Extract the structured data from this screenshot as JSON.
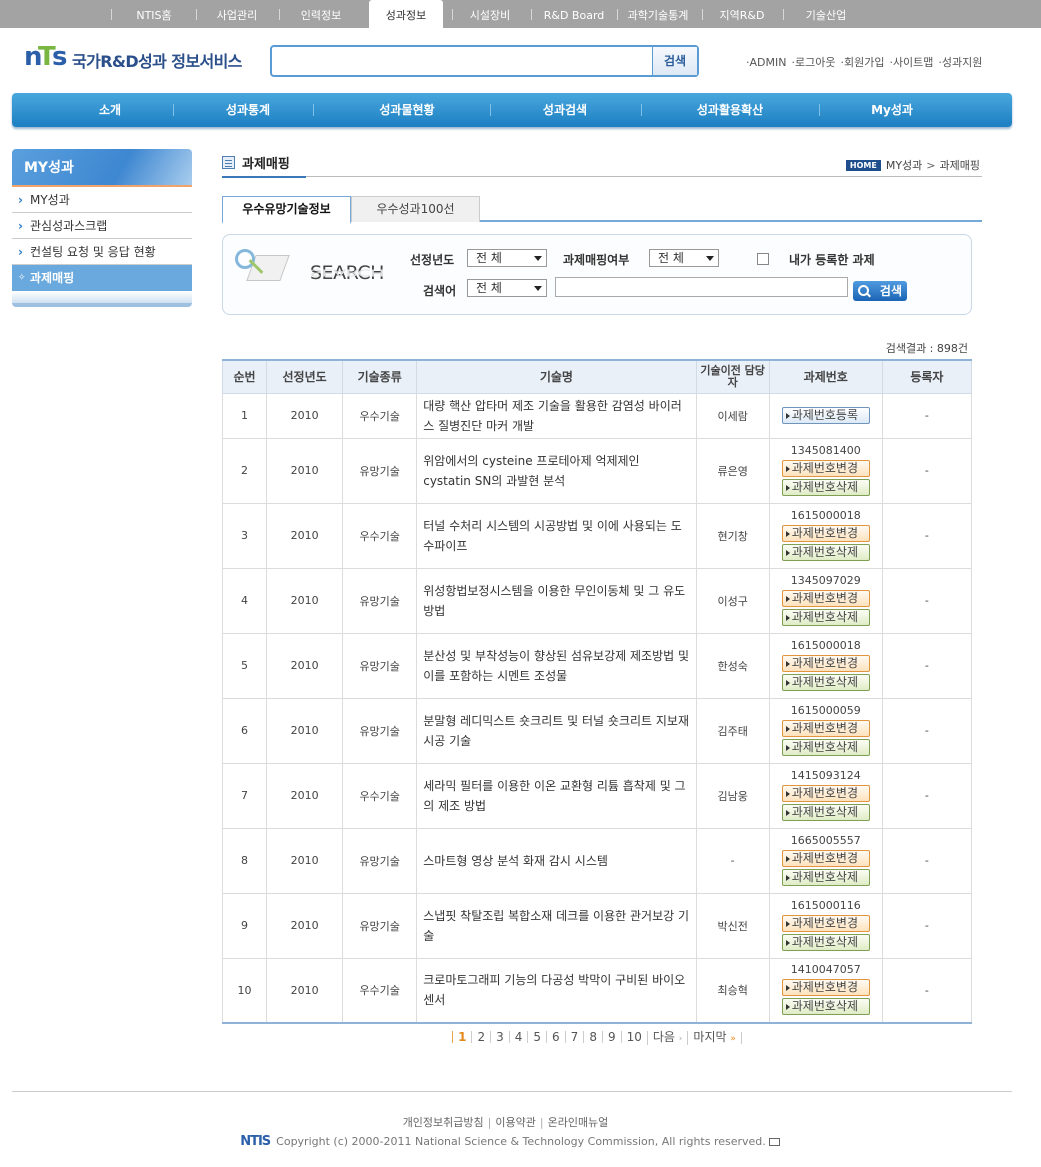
{
  "topnav": {
    "items": [
      "NTIS홈",
      "사업관리",
      "인력정보",
      "성과정보",
      "시설장비",
      "R&D Board",
      "과학기술통계",
      "지역R&D",
      "기술산업"
    ]
  },
  "header": {
    "logo_mark": "NTIS",
    "logo_text": "국가R&D성과 정보서비스",
    "search_placeholder": "",
    "search_button": "검색",
    "util_links": [
      "ADMIN",
      "로그아웃",
      "회원가입",
      "사이트맵",
      "성과지원"
    ]
  },
  "gnb": {
    "items": [
      "소개",
      "성과통계",
      "성과물현황",
      "성과검색",
      "성과활용확산",
      "My성과"
    ]
  },
  "sidebar": {
    "title": "MY성과",
    "items": [
      "MY성과",
      "관심성과스크랩",
      "컨설팅 요청 및 응답 현황",
      "과제매핑"
    ]
  },
  "page": {
    "title": "과제매핑",
    "breadcrumb_home": "HOME",
    "breadcrumb": [
      "MY성과",
      "과제매핑"
    ]
  },
  "tabs": [
    "우수유망기술정보",
    "우수성과100선"
  ],
  "search": {
    "word": "SEARCH",
    "year_label": "선정년도",
    "year_value": "전 체",
    "mapping_label": "과제매핑여부",
    "mapping_value": "전 체",
    "my_task_label": "내가 등록한 과제",
    "keyword_label": "검색어",
    "keyword_type": "전 체",
    "keyword_value": "",
    "button": "검색"
  },
  "result_count": "검색결과 : 898건",
  "table": {
    "headers": [
      "순번",
      "선정년도",
      "기술종류",
      "기술명",
      "기술이전 담당자",
      "과제번호",
      "등록자"
    ],
    "btn_register": "과제번호등록",
    "btn_change": "과제번호변경",
    "btn_delete": "과제번호삭제",
    "rows": [
      {
        "no": "1",
        "year": "2010",
        "type": "우수기술",
        "name": "대량 핵산 압타머 제조 기술을 활용한 감염성 바이러스 질병진단 마커 개발",
        "manager": "이세람",
        "project": "",
        "registrant": "-"
      },
      {
        "no": "2",
        "year": "2010",
        "type": "유망기술",
        "name": "위암에서의 cysteine 프로테아제 억제제인 cystatin SN의 과발현 분석",
        "manager": "류은영",
        "project": "1345081400",
        "registrant": "-"
      },
      {
        "no": "3",
        "year": "2010",
        "type": "우수기술",
        "name": "터널 수처리 시스템의 시공방법 및 이에 사용되는 도수파이프",
        "manager": "현기창",
        "project": "1615000018",
        "registrant": "-"
      },
      {
        "no": "4",
        "year": "2010",
        "type": "유망기술",
        "name": "위성항법보정시스템을 이용한 무인이동체 및 그 유도방법",
        "manager": "이성구",
        "project": "1345097029",
        "registrant": "-"
      },
      {
        "no": "5",
        "year": "2010",
        "type": "유망기술",
        "name": "분산성 및 부착성능이 향상된 섬유보강제 제조방법 및 이를 포함하는 시멘트 조성물",
        "manager": "한성숙",
        "project": "1615000018",
        "registrant": "-"
      },
      {
        "no": "6",
        "year": "2010",
        "type": "유망기술",
        "name": "분말형 레디믹스트 숏크리트 및 터널 숏크리트 지보재 시공 기술",
        "manager": "김주태",
        "project": "1615000059",
        "registrant": "-"
      },
      {
        "no": "7",
        "year": "2010",
        "type": "우수기술",
        "name": "세라믹 필터를 이용한 이온 교환형 리튬 흡착제 및 그의 제조 방법",
        "manager": "김남웅",
        "project": "1415093124",
        "registrant": "-"
      },
      {
        "no": "8",
        "year": "2010",
        "type": "유망기술",
        "name": "스마트형 영상 분석 화재 감시 시스템",
        "manager": "-",
        "project": "1665005557",
        "registrant": "-"
      },
      {
        "no": "9",
        "year": "2010",
        "type": "유망기술",
        "name": "스냅핏 착탈조립 복합소재 데크를 이용한 관거보강 기술",
        "manager": "박신전",
        "project": "1615000116",
        "registrant": "-"
      },
      {
        "no": "10",
        "year": "2010",
        "type": "우수기술",
        "name": "크로마토그래피 기능의 다공성 박막이 구비된 바이오센서",
        "manager": "최승혁",
        "project": "1410047057",
        "registrant": "-"
      }
    ]
  },
  "paging": {
    "pages": [
      "1",
      "2",
      "3",
      "4",
      "5",
      "6",
      "7",
      "8",
      "9",
      "10"
    ],
    "current": "1",
    "next": "다음",
    "last": "마지막"
  },
  "footer": {
    "links": [
      "개인정보취급방침",
      "이용약관",
      "온라인매뉴얼"
    ],
    "copyright": "Copyright (c) 2000-2011 National Science & Technology Commission, All rights reserved."
  }
}
